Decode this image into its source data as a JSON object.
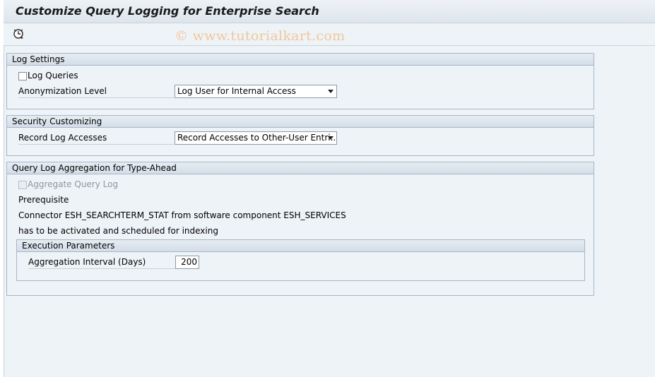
{
  "window": {
    "title": "Customize Query Logging for Enterprise Search",
    "watermark": "© www.tutorialkart.com"
  },
  "toolbar": {
    "execute_icon": "execute-clock-icon"
  },
  "log_settings": {
    "header": "Log Settings",
    "log_queries_label": "Log Queries",
    "log_queries_checked": false,
    "anonymization_label": "Anonymization Level",
    "anonymization_value": "Log User for Internal Access"
  },
  "security": {
    "header": "Security Customizing",
    "record_label": "Record Log Accesses",
    "record_value": "Record Accesses to Other-User Entri..."
  },
  "aggregation": {
    "header": "Query Log Aggregation for Type-Ahead",
    "aggregate_label": "Aggregate Query Log",
    "aggregate_checked": false,
    "prerequisite": "Prerequisite",
    "line1": "Connector ESH_SEARCHTERM_STAT from software component ESH_SERVICES",
    "line2": "has to be activated and scheduled for indexing",
    "exec_params": {
      "header": "Execution Parameters",
      "interval_label": "Aggregation Interval (Days)",
      "interval_value": "200"
    }
  }
}
